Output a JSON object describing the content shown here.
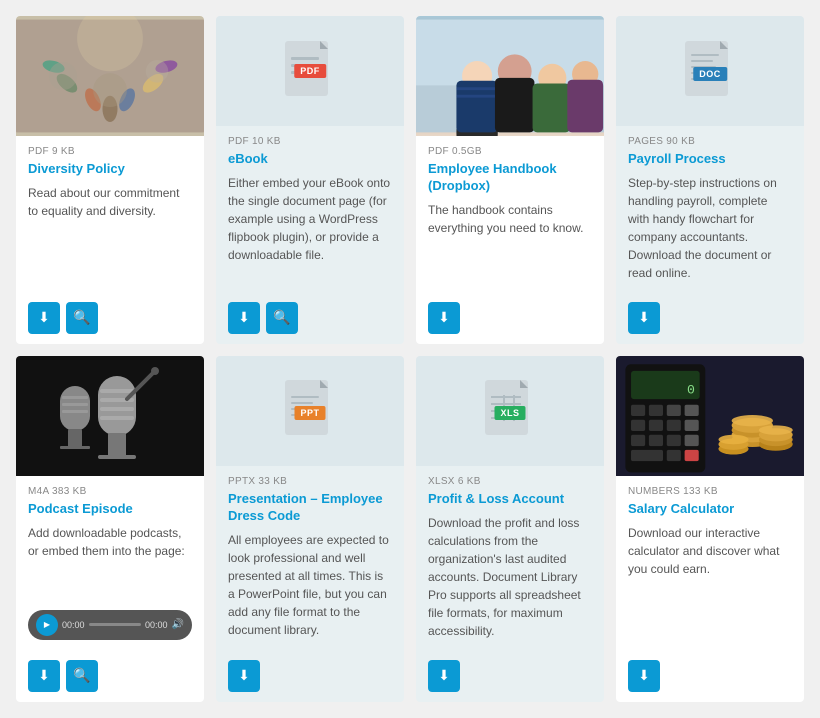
{
  "cards": [
    {
      "id": "diversity-policy",
      "type": "image",
      "image_type": "people",
      "file_meta": "PDF  9 KB",
      "title": "Diversity Policy",
      "description": "Read about our commitment to equality and diversity.",
      "has_download": true,
      "has_search": true,
      "bg": "white"
    },
    {
      "id": "ebook",
      "type": "file-icon",
      "file_type": "PDF",
      "file_meta": "PDF  10 KB",
      "title": "eBook",
      "description": "Either embed your eBook onto the single document page (for example using a WordPress flipbook plugin), or provide a downloadable file.",
      "has_download": true,
      "has_search": true,
      "bg": "teal"
    },
    {
      "id": "employee-handbook",
      "type": "image",
      "image_type": "women",
      "file_meta": "PDF  0.5GB",
      "title": "Employee Handbook (Dropbox)",
      "description": "The handbook contains everything you need to know.",
      "has_download": true,
      "has_search": false,
      "bg": "white"
    },
    {
      "id": "payroll-process",
      "type": "file-icon",
      "file_type": "DOC",
      "file_meta": "PAGES  90 KB",
      "title": "Payroll Process",
      "description": "Step-by-step instructions on handling payroll, complete with handy flowchart for company accountants. Download the document or read online.",
      "has_download": true,
      "has_search": false,
      "bg": "teal"
    },
    {
      "id": "podcast-episode",
      "type": "image",
      "image_type": "podcast",
      "file_meta": "M4A  383 KB",
      "title": "Podcast Episode",
      "description": "Add downloadable podcasts, or embed them into the page:",
      "has_download": true,
      "has_search": true,
      "has_player": true,
      "bg": "white"
    },
    {
      "id": "presentation-dress-code",
      "type": "file-icon",
      "file_type": "PPT",
      "file_meta": "PPTX  33 KB",
      "title": "Presentation – Employee Dress Code",
      "description": "All employees are expected to look professional and well presented at all times. This is a PowerPoint file, but you can add any file format to the document library.",
      "has_download": true,
      "has_search": false,
      "bg": "teal"
    },
    {
      "id": "profit-loss-account",
      "type": "file-icon",
      "file_type": "XLS",
      "file_meta": "XLSX  6 KB",
      "title": "Profit & Loss Account",
      "description": "Download the profit and loss calculations from the organization's last audited accounts. Document Library Pro supports all spreadsheet file formats, for maximum accessibility.",
      "has_download": true,
      "has_search": false,
      "bg": "teal"
    },
    {
      "id": "salary-calculator",
      "type": "image",
      "image_type": "salary",
      "file_meta": "NUMBERS  133 KB",
      "title": "Salary Calculator",
      "description": "Download our interactive calculator and discover what you could earn.",
      "has_download": true,
      "has_search": false,
      "bg": "white"
    }
  ],
  "icons": {
    "download": "⬇",
    "search": "🔍",
    "play": "▶"
  },
  "player": {
    "time_start": "00:00",
    "time_end": "00:00"
  }
}
